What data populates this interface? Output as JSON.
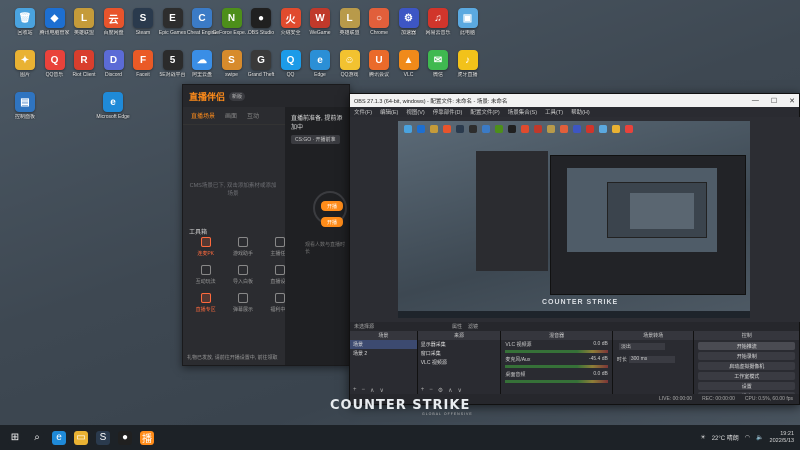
{
  "desktop": {
    "icons": [
      {
        "label": "回收站",
        "color": "#4aa3df",
        "glyph": "🗑"
      },
      {
        "label": "腾讯电脑管家",
        "color": "#1d6fd1",
        "glyph": "◆"
      },
      {
        "label": "英雄联盟",
        "color": "#c59b3a",
        "glyph": "L"
      },
      {
        "label": "百度网盘",
        "color": "#e8542c",
        "glyph": "云"
      },
      {
        "label": "Steam",
        "color": "#2a3a4d",
        "glyph": "S"
      },
      {
        "label": "Epic Games",
        "color": "#2d2d2d",
        "glyph": "E"
      },
      {
        "label": "Cheat Engine",
        "color": "#3b7bc6",
        "glyph": "C"
      },
      {
        "label": "GeForce Experience",
        "color": "#4d8f1a",
        "glyph": "N"
      },
      {
        "label": "OBS Studio",
        "color": "#202020",
        "glyph": "●"
      },
      {
        "label": "火绒安全",
        "color": "#e04b2e",
        "glyph": "火"
      },
      {
        "label": "WeGame",
        "color": "#c0392b",
        "glyph": "W"
      },
      {
        "label": "英雄联盟",
        "color": "#b89a4a",
        "glyph": "L"
      },
      {
        "label": "Chrome",
        "color": "#e15f3b",
        "glyph": "○"
      },
      {
        "label": "加速器",
        "color": "#3d56c4",
        "glyph": "⚙"
      },
      {
        "label": "网易云音乐",
        "color": "#d1352b",
        "glyph": "♫"
      },
      {
        "label": "此电脑",
        "color": "#5ba9e0",
        "glyph": "▣"
      },
      {
        "label": "图片",
        "color": "#e9b233",
        "glyph": "✦"
      },
      {
        "label": "QQ音乐",
        "color": "#e9423b",
        "glyph": "Q"
      },
      {
        "label": "Riot Client",
        "color": "#d93e2d",
        "glyph": "R"
      },
      {
        "label": "Discord",
        "color": "#5b6bd6",
        "glyph": "D"
      },
      {
        "label": "Faceit",
        "color": "#ea5a26",
        "glyph": "F"
      },
      {
        "label": "5E对战平台",
        "color": "#2b2b2b",
        "glyph": "5"
      },
      {
        "label": "阿里云盘",
        "color": "#3a8ee6",
        "glyph": "☁"
      },
      {
        "label": "swipe",
        "color": "#d78b2c",
        "glyph": "S"
      },
      {
        "label": "Grand Theft",
        "color": "#3a3a3a",
        "glyph": "G"
      },
      {
        "label": "QQ",
        "color": "#1c9be8",
        "glyph": "Q"
      },
      {
        "label": "Edge",
        "color": "#2b8fd6",
        "glyph": "e"
      },
      {
        "label": "QQ游戏",
        "color": "#f2c230",
        "glyph": "☺"
      },
      {
        "label": "腾讯会议",
        "color": "#ea6a2a",
        "glyph": "U"
      },
      {
        "label": "VLC",
        "color": "#f08a1a",
        "glyph": "▲"
      },
      {
        "label": "微信",
        "color": "#3fb950",
        "glyph": "✉"
      },
      {
        "label": "虎牙直播",
        "color": "#f2c21a",
        "glyph": "♪"
      },
      {
        "label": "控制面板",
        "color": "#2f74c0",
        "glyph": "▤"
      },
      {
        "label": "Microsoft Edge",
        "color": "#1f8ad8",
        "glyph": "e"
      }
    ]
  },
  "zbb": {
    "logo": "直播伴侣",
    "version": "新版",
    "tabs": [
      "直播场景",
      "画面",
      "互动"
    ],
    "empty_text": "CMS场景已下, 双击添加素材或添加场景",
    "tools_title": "工具箱",
    "tools": [
      "连麦PK",
      "游戏助手",
      "主播任务",
      "互动玩法",
      "导入白板",
      "直播设置",
      "直播专区",
      "弹幕展示",
      "福利中心"
    ],
    "side_title": "直播前准备, 提前添加中",
    "side_chip": "CS:GO · 开播前准",
    "btn1": "开播",
    "btn2": "开播",
    "side_hint": "观看人数与直播时长",
    "notice": "礼物已发放, 请前往开播设置中, 前往领取"
  },
  "obs": {
    "title": "OBS 27.1.3 (64-bit, windows) - 配置文件: 未命名 - 场景: 未命名",
    "window_controls": [
      "—",
      "☐",
      "✕"
    ],
    "menu": [
      "文件(F)",
      "编辑(E)",
      "视图(V)",
      "停靠部件(D)",
      "配置文件(P)",
      "场景集合(S)",
      "工具(T)",
      "帮助(H)"
    ],
    "preview_logo": "COUNTER STRIKE",
    "status": {
      "source": "未选择源",
      "props": "属性",
      "filters": "滤镜"
    },
    "docks": {
      "scenes": {
        "header": "场景",
        "items": [
          "场景",
          "场景 2"
        ]
      },
      "sources": {
        "header": "来源",
        "items": [
          "显示器采集",
          "窗口采集",
          "VLC 视频源"
        ]
      },
      "mixer": {
        "header": "混音器",
        "channels": [
          {
            "name": "VLC 视频源",
            "db": "0.0 dB"
          },
          {
            "name": "麦克风/Aux",
            "db": "-45.4 dB"
          },
          {
            "name": "桌面音频",
            "db": "0.0 dB"
          }
        ]
      },
      "transitions": {
        "header": "场景转场",
        "type_label": "淡出",
        "duration_label": "时长",
        "duration_value": "300 ms"
      },
      "controls": {
        "header": "控制",
        "buttons": [
          "开始推流",
          "开始录制",
          "启动虚拟摄像机",
          "工作室模式",
          "设置",
          "退出"
        ]
      }
    },
    "bottom": [
      "LIVE: 00:00:00",
      "REC: 00:00:00",
      "CPU: 0.5%, 60.00 fps"
    ]
  },
  "cs_logo": "COUNTER STRIKE",
  "cs_sub": "GLOBAL OFFENSIVE",
  "taskbar": {
    "pinned": [
      {
        "name": "windows",
        "color": "#1d2227",
        "glyph": "⊞"
      },
      {
        "name": "search",
        "color": "#1d2227",
        "glyph": "⌕"
      },
      {
        "name": "edge",
        "color": "#1f8ad8",
        "glyph": "e"
      },
      {
        "name": "explorer",
        "color": "#e9b233",
        "glyph": "▭"
      },
      {
        "name": "steam",
        "color": "#2a3a4d",
        "glyph": "S"
      },
      {
        "name": "obs",
        "color": "#202020",
        "glyph": "●"
      },
      {
        "name": "zbb",
        "color": "#ff8c1a",
        "glyph": "播"
      }
    ],
    "weather": "22°C 晴朗",
    "time": "19:21",
    "date": "2022/5/13"
  }
}
